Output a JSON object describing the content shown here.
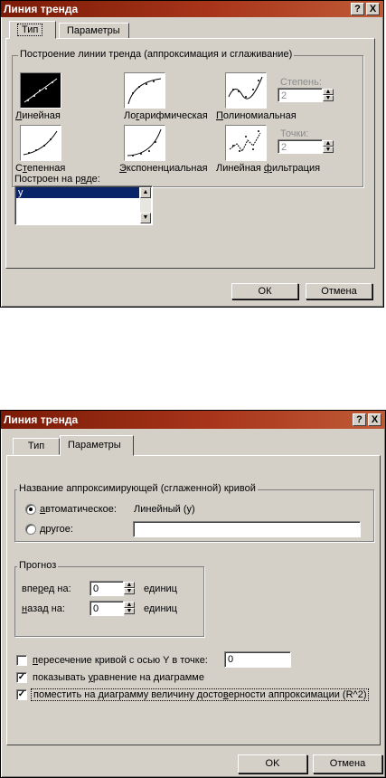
{
  "dialog1": {
    "title": "Линия тренда",
    "help_label": "?",
    "close_label": "X",
    "tabs": [
      "Тип",
      "Параметры"
    ],
    "group_label": "Построение линии тренда (аппроксимация и сглаживание)",
    "types": [
      {
        "label_pre": "",
        "label_u": "Л",
        "label_post": "инейная"
      },
      {
        "label_pre": "Ло",
        "label_u": "г",
        "label_post": "арифмическая"
      },
      {
        "label_pre": "",
        "label_u": "П",
        "label_post": "олиномиальная"
      },
      {
        "label_pre": "С",
        "label_u": "т",
        "label_post": "епенная"
      },
      {
        "label_pre": "",
        "label_u": "Э",
        "label_post": "кспоненциальная"
      },
      {
        "label_pre": "Линейная ",
        "label_u": "ф",
        "label_post": "ильтрация"
      }
    ],
    "degree_label": "Степень:",
    "degree_value": "2",
    "points_label": "Точки:",
    "points_value": "2",
    "series_label_pre": "Построен на р",
    "series_label_u": "я",
    "series_label_post": "де:",
    "series_items": [
      "y"
    ],
    "ok_label": "ОК",
    "cancel_label": "Отмена"
  },
  "dialog2": {
    "title": "Линия тренда",
    "help_label": "?",
    "close_label": "X",
    "tabs": [
      "Тип",
      "Параметры"
    ],
    "name_group_label": "Название аппроксимирующей (сглаженной) кривой",
    "auto_label_pre": "",
    "auto_label_u": "а",
    "auto_label_post": "втоматическое:",
    "auto_value": "Линейный (y)",
    "other_label_pre": "",
    "other_label_u": "д",
    "other_label_post": "ругое:",
    "other_value": "",
    "forecast_group_label": "Прогноз",
    "forward_label_pre": "впе",
    "forward_label_u": "р",
    "forward_label_post": "ед на:",
    "forward_value": "0",
    "backward_label_pre": "",
    "backward_label_u": "н",
    "backward_label_post": "азад на:",
    "backward_value": "0",
    "units_label": "единиц",
    "intercept_label_pre": "",
    "intercept_label_u": "п",
    "intercept_label_post": "ересечение кривой с осью Y в точке:",
    "intercept_value": "0",
    "intercept_checked": false,
    "show_eq_label_pre": "показывать ",
    "show_eq_label_u": "у",
    "show_eq_label_post": "равнение на диаграмме",
    "show_eq_checked": true,
    "show_r2_label_pre": "поместить на диаграмму величину досто",
    "show_r2_label_u": "в",
    "show_r2_label_post": "ерности аппроксимации (R^2)",
    "show_r2_checked": true,
    "check_mark": "✓",
    "ok_label": "OK",
    "cancel_label": "Отмена"
  }
}
